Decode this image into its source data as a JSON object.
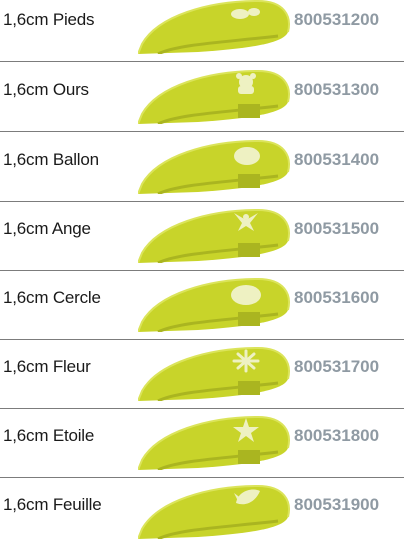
{
  "colors": {
    "punch_body": "#c8d42a",
    "punch_dark": "#aab520",
    "punch_light": "#dbe45a",
    "punch_base": "#d6dd6c",
    "shape_cutout": "#eef1c2",
    "code_text": "#8f9aa3",
    "label_text": "#1a1a1a",
    "divider": "#7c7c7c"
  },
  "products": [
    {
      "label": "1,6cm Pieds",
      "code": "800531200",
      "shape_icon": "feet-icon"
    },
    {
      "label": "1,6cm Ours",
      "code": "800531300",
      "shape_icon": "bear-icon"
    },
    {
      "label": "1,6cm Ballon",
      "code": "800531400",
      "shape_icon": "balloon-icon"
    },
    {
      "label": "1,6cm Ange",
      "code": "800531500",
      "shape_icon": "angel-icon"
    },
    {
      "label": "1,6cm Cercle",
      "code": "800531600",
      "shape_icon": "circle-icon"
    },
    {
      "label": "1,6cm Fleur",
      "code": "800531700",
      "shape_icon": "flower-icon"
    },
    {
      "label": "1,6cm Etoile",
      "code": "800531800",
      "shape_icon": "star-icon"
    },
    {
      "label": "1,6cm Feuille",
      "code": "800531900",
      "shape_icon": "leaf-icon"
    }
  ]
}
